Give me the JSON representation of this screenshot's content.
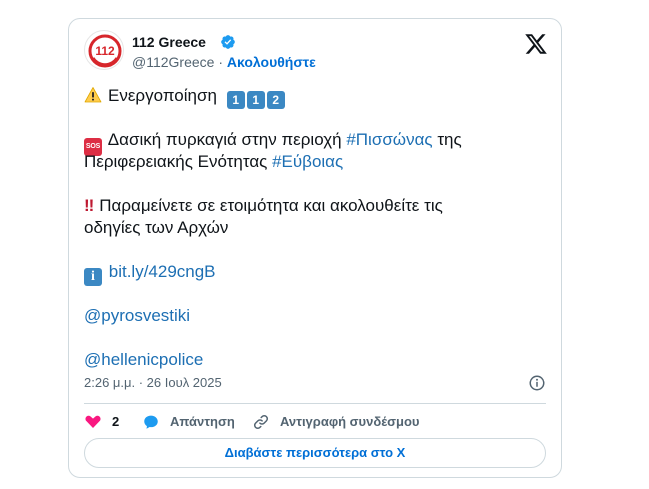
{
  "tweet": {
    "author": {
      "name": "112 Greece",
      "handle": "@112Greece",
      "separator": "·",
      "follow_label": "Ακολουθήστε",
      "avatar_text": "112"
    },
    "lines": {
      "l1": "Ενεργοποίηση",
      "keycaps": [
        "1",
        "1",
        "2"
      ],
      "l2_prefix": " Δασική πυρκαγιά στην περιοχή ",
      "l2_hashtag": "#Πισσώνας",
      "l2_suffix": " της",
      "l3_prefix": "Περιφερειακής Ενότητας ",
      "l3_hashtag": "#Εύβοιας",
      "l4_bang": "‼",
      "l4": "Παραμείνετε σε ετοιμότητα και ακολουθείτε τις",
      "l5": "οδηγίες των Αρχών",
      "link": "bit.ly/429cngB",
      "mention1": "@pyrosvestiki",
      "mention2": "@hellenicpolice",
      "sos_label": "SOS",
      "info_label": "i"
    },
    "timestamp": "2:26 μ.μ. · 26 Ιουλ 2025",
    "actions": {
      "like_count": "2",
      "reply_label": "Απάντηση",
      "copy_label": "Αντιγραφή συνδέσμου"
    },
    "read_more_label": "Διαβάστε περισσότερα στο X"
  },
  "colors": {
    "accent": "#1d9bf0",
    "link": "#1d6fb3",
    "heart": "#f91880",
    "avatar_red": "#d7262b"
  },
  "icons": [
    "verified-icon",
    "x-logo-icon",
    "warning-icon",
    "keycap-icon",
    "sos-icon",
    "double-exclamation-icon",
    "info-emoji-icon",
    "info-icon",
    "heart-icon",
    "reply-icon",
    "link-icon"
  ]
}
